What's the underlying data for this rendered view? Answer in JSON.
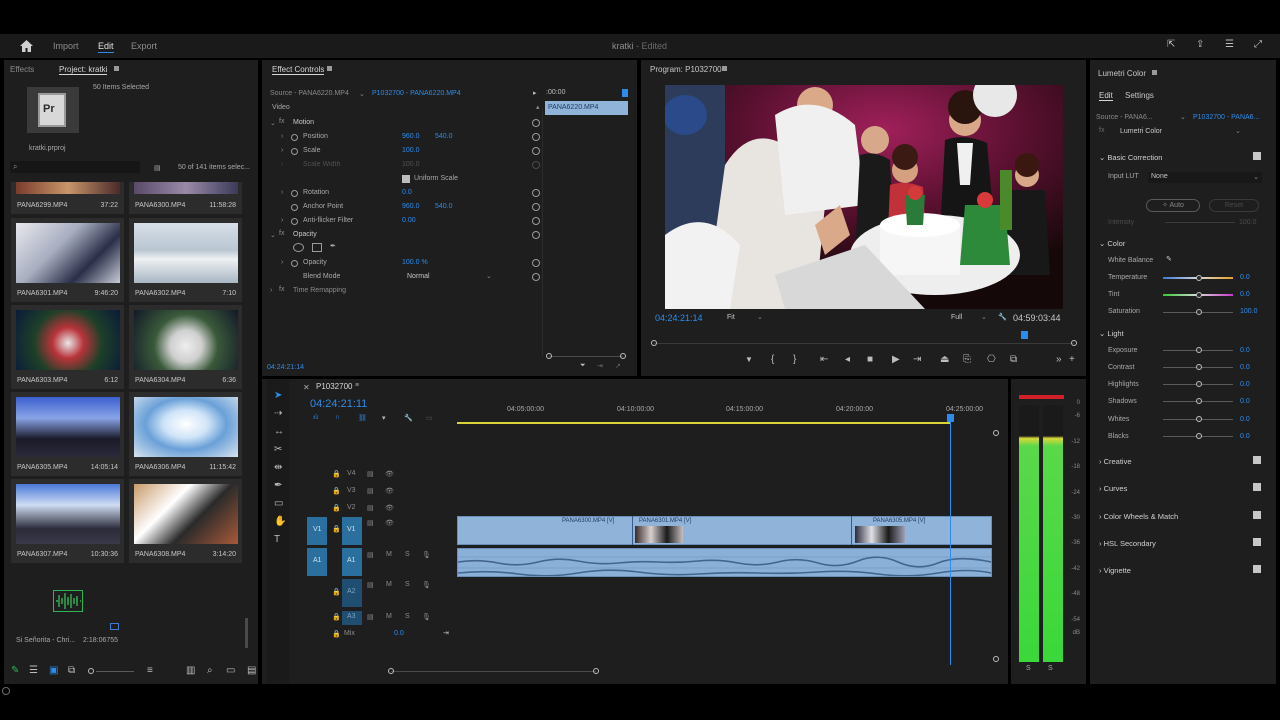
{
  "app": {
    "title": "kratki",
    "status": "- Edited",
    "menu": {
      "import": "Import",
      "edit": "Edit",
      "export": "Export"
    },
    "home_icon": "home-icon",
    "accent": "#2d8ceb"
  },
  "project_panel": {
    "tabs": {
      "effects": "Effects",
      "project": "Project: kratki"
    },
    "selection": "50 Items Selected",
    "proj_file": "kratki.prproj",
    "item_count": "50 of 141 items selec...",
    "top_row": [
      {
        "name": "PANA6299.MP4",
        "duration": "37:22"
      },
      {
        "name": "PANA6300.MP4",
        "duration": "11:58:28"
      }
    ],
    "clips": [
      {
        "name": "PANA6301.MP4",
        "duration": "9:46:20"
      },
      {
        "name": "PANA6302.MP4",
        "duration": "7:10"
      },
      {
        "name": "PANA6303.MP4",
        "duration": "6:12"
      },
      {
        "name": "PANA6304.MP4",
        "duration": "6:36"
      },
      {
        "name": "PANA6305.MP4",
        "duration": "14:05:14"
      },
      {
        "name": "PANA6306.MP4",
        "duration": "11:15:42"
      },
      {
        "name": "PANA6307.MP4",
        "duration": "10:30:36"
      },
      {
        "name": "PANA6308.MP4",
        "duration": "3:14:20"
      }
    ],
    "audio_item": {
      "name": "Si Señorita - Chri...",
      "duration": "2:18:06755"
    }
  },
  "effect_controls": {
    "tab": "Effect Controls",
    "source": "Source - PANA6220.MP4",
    "sequence": "P1032700 - PANA6220.MP4",
    "timecode_head": ":00:00",
    "clip_label": "PANA6220.MP4",
    "section_video": "Video",
    "motion": "Motion",
    "position": {
      "label": "Position",
      "x": "960.0",
      "y": "540.0"
    },
    "scale": {
      "label": "Scale",
      "value": "100.0"
    },
    "scale_width": {
      "label": "Scale Width",
      "value": "100.0"
    },
    "uniform_scale": "Uniform Scale",
    "rotation": {
      "label": "Rotation",
      "value": "0.0"
    },
    "anchor": {
      "label": "Anchor Point",
      "x": "960.0",
      "y": "540.0"
    },
    "antiflicker": {
      "label": "Anti-flicker Filter",
      "value": "0.00"
    },
    "opacity_group": "Opacity",
    "opacity": {
      "label": "Opacity",
      "value": "100.0 %"
    },
    "blend": {
      "label": "Blend Mode",
      "value": "Normal"
    },
    "time_remap": "Time Remapping",
    "current_time": "04:24:21:14"
  },
  "program": {
    "tab": "Program: P1032700",
    "timecode": "04:24:21:14",
    "fit": "Fit",
    "quality": "Full",
    "duration": "04:59:03:44"
  },
  "timeline": {
    "sequence": "P1032700",
    "timecode": "04:24:21:11",
    "ruler": [
      "04:05:00:00",
      "04:10:00:00",
      "04:15:00:00",
      "04:20:00:00",
      "04:25:00:00"
    ],
    "tracks": {
      "v4": "V4",
      "v3": "V3",
      "v2": "V2",
      "v1": "V1",
      "a1": "A1",
      "a2": "A2",
      "a3": "A3",
      "mix": "Mix",
      "mix_val": "0.0"
    },
    "clips": [
      {
        "name": "PANA6300.MP4 [V]"
      },
      {
        "name": "PANA6301.MP4 [V]"
      },
      {
        "name": "PANA6305.MP4 [V]"
      }
    ]
  },
  "meter": {
    "labels": [
      "0",
      "-6",
      "-12",
      "-18",
      "-24",
      "-30",
      "-36",
      "-42",
      "-48",
      "-54",
      "dB"
    ],
    "solo": [
      "S",
      "S"
    ]
  },
  "lumetri": {
    "tab": "Lumetri Color",
    "subtabs": {
      "edit": "Edit",
      "settings": "Settings"
    },
    "source": "Source - PANA6...",
    "sequence": "P1032700 - PANA6...",
    "effect": "Lumetri Color",
    "basic": "Basic Correction",
    "input_lut": {
      "label": "Input LUT",
      "value": "None"
    },
    "auto": "Auto",
    "reset": "Reset",
    "intensity": {
      "label": "Intensity",
      "value": "100.0"
    },
    "color": "Color",
    "white_balance": "White Balance",
    "temperature": {
      "label": "Temperature",
      "value": "0.0"
    },
    "tint": {
      "label": "Tint",
      "value": "0.0"
    },
    "saturation": {
      "label": "Saturation",
      "value": "100.0"
    },
    "light": "Light",
    "exposure": {
      "label": "Exposure",
      "value": "0.0"
    },
    "contrast": {
      "label": "Contrast",
      "value": "0.0"
    },
    "highlights": {
      "label": "Highlights",
      "value": "0.0"
    },
    "shadows": {
      "label": "Shadows",
      "value": "0.0"
    },
    "whites": {
      "label": "Whites",
      "value": "0.0"
    },
    "blacks": {
      "label": "Blacks",
      "value": "0.0"
    },
    "sections": [
      "Creative",
      "Curves",
      "Color Wheels & Match",
      "HSL Secondary",
      "Vignette"
    ]
  }
}
